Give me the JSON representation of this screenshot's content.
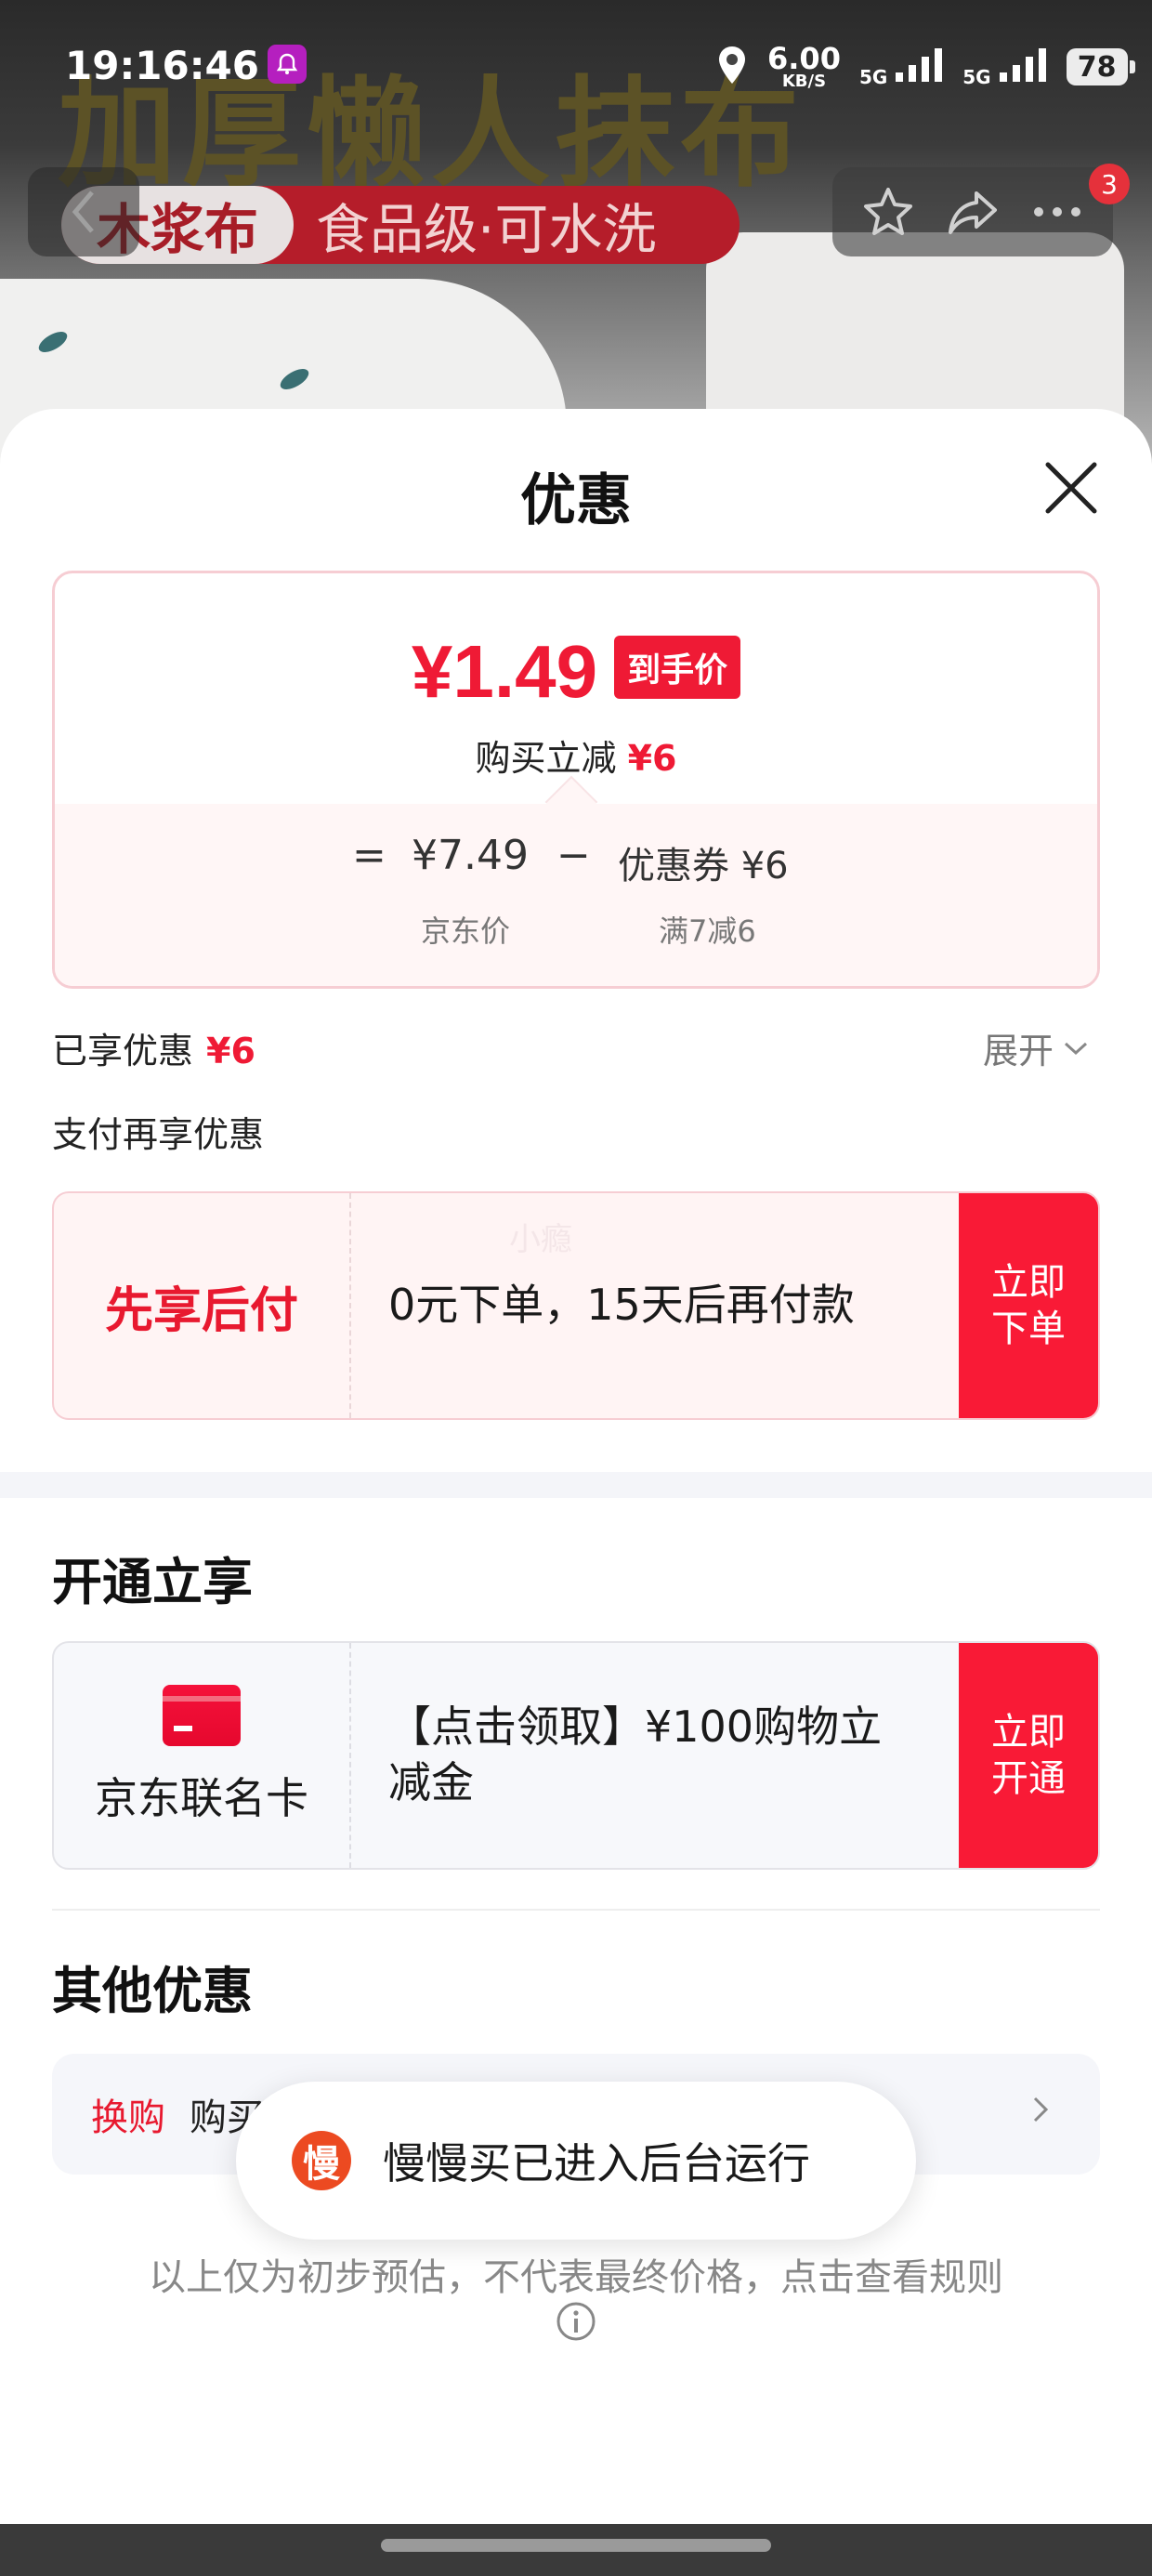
{
  "status_bar": {
    "time": "19:16:46",
    "net_speed": "6.00",
    "net_unit": "KB/S",
    "signal_1": "5G",
    "signal_2": "5G",
    "battery": "78"
  },
  "product_banner": {
    "title": "加厚懒人抹布",
    "pill_left": "木浆布",
    "pill_right": "食品级·可水洗",
    "cart_badge": "3"
  },
  "sheet": {
    "title": "优惠",
    "price_summary": {
      "final_price": "¥1.49",
      "final_tag": "到手价",
      "reduction_label": "购买立减",
      "reduction_value": "¥6",
      "equals": "=",
      "jd_price": "¥7.49",
      "jd_price_label": "京东价",
      "minus": "−",
      "coupon_value": "优惠券 ¥6",
      "coupon_label": "满7减6"
    },
    "enjoyed": {
      "label": "已享优惠",
      "value": "¥6",
      "expand_label": "展开"
    },
    "pay_more_label": "支付再享优惠",
    "pay_later": {
      "name": "先享后付",
      "watermark": "小瘾",
      "desc": "0元下单，15天后再付款",
      "button": "立即下单"
    },
    "open_section": {
      "title": "开通立享",
      "card_name": "京东联名卡",
      "desc": "【点击领取】¥100购物立减金",
      "button": "立即开通"
    },
    "other_section": {
      "title": "其他优惠",
      "tag": "换购",
      "text": "购买"
    },
    "toast": {
      "icon_char": "慢",
      "text": "慢慢买已进入后台运行"
    },
    "disclaimer": "以上仅为初步预估，不代表最终价格，点击查看规则"
  },
  "colors": {
    "accent_red": "#ef1a35",
    "button_red": "#f91a36",
    "toast_icon": "#ec4a21"
  }
}
